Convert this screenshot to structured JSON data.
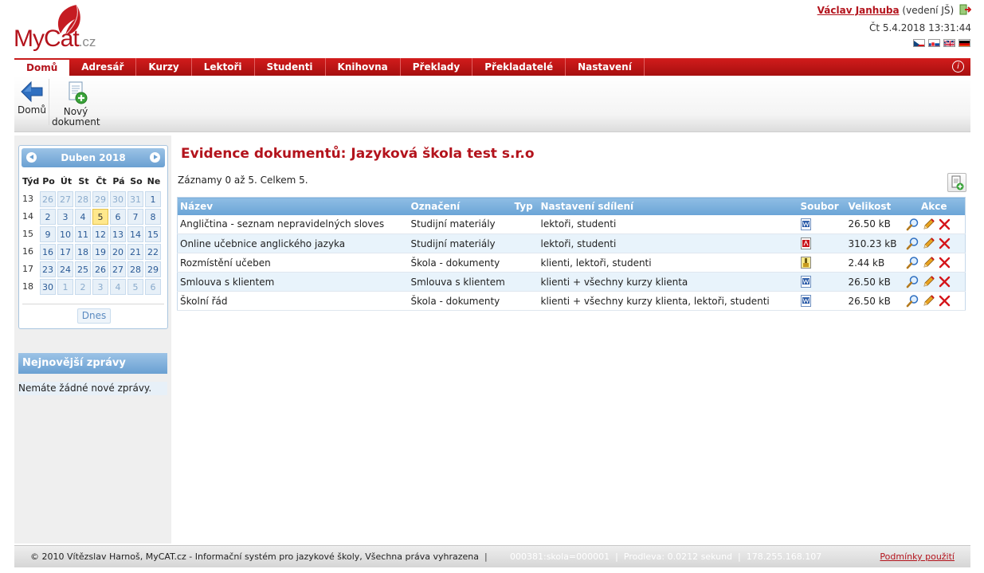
{
  "logo": {
    "text_my": "My",
    "text_cat": "Cat",
    "text_cz": ".cz"
  },
  "user": {
    "name": "Václav Janhuba",
    "role": "(vedení JŠ)",
    "datetime": "Čt 5.4.2018 13:31:44"
  },
  "languages": [
    "cs",
    "sk",
    "en",
    "de"
  ],
  "nav": {
    "items": [
      "Domů",
      "Adresář",
      "Kurzy",
      "Lektoři",
      "Studenti",
      "Knihovna",
      "Překlady",
      "Překladatelé",
      "Nastavení"
    ],
    "active": "Domů",
    "info": "i"
  },
  "toolbar": {
    "home_label": "Domů",
    "new_doc_line1": "Nový",
    "new_doc_line2": "dokument"
  },
  "calendar": {
    "month": "Duben 2018",
    "headers": [
      "Týd",
      "Po",
      "Út",
      "St",
      "Čt",
      "Pá",
      "So",
      "Ne"
    ],
    "weeks": [
      {
        "no": "13",
        "days": [
          "26",
          "27",
          "28",
          "29",
          "30",
          "31",
          "1"
        ]
      },
      {
        "no": "14",
        "days": [
          "2",
          "3",
          "4",
          "5",
          "6",
          "7",
          "8"
        ]
      },
      {
        "no": "15",
        "days": [
          "9",
          "10",
          "11",
          "12",
          "13",
          "14",
          "15"
        ]
      },
      {
        "no": "16",
        "days": [
          "16",
          "17",
          "18",
          "19",
          "20",
          "21",
          "22"
        ]
      },
      {
        "no": "17",
        "days": [
          "23",
          "24",
          "25",
          "26",
          "27",
          "28",
          "29"
        ]
      },
      {
        "no": "18",
        "days": [
          "30",
          "1",
          "2",
          "3",
          "4",
          "5",
          "6"
        ]
      }
    ],
    "today": "5",
    "today_button": "Dnes"
  },
  "news": {
    "title": "Nejnovější zprávy",
    "empty": "Nemáte žádné nové zprávy."
  },
  "main": {
    "title": "Evidence dokumentů: Jazyková škola test s.r.o",
    "records": "Záznamy 0 až 5. Celkem 5.",
    "columns": [
      "Název",
      "Označení",
      "Typ",
      "Nastavení sdílení",
      "Soubor",
      "Velikost",
      "Akce"
    ],
    "rows": [
      {
        "name": "Angličtina - seznam nepravidelných sloves",
        "label": "Studijní materiály",
        "type": "",
        "sharing": "lektoři, studenti",
        "file": "word-icon",
        "size": "26.50 kB"
      },
      {
        "name": "Online učebnice anglického jazyka",
        "label": "Studijní materiály",
        "type": "",
        "sharing": "lektoři, studenti",
        "file": "pdf-icon",
        "size": "310.23 kB"
      },
      {
        "name": "Rozmístění učeben",
        "label": "Škola - dokumenty",
        "type": "",
        "sharing": "klienti, lektoři, studenti",
        "file": "archive-icon",
        "size": "2.44 kB"
      },
      {
        "name": "Smlouva s klientem",
        "label": "Smlouva s klientem",
        "type": "",
        "sharing": "klienti + všechny kurzy klienta",
        "file": "word-icon",
        "size": "26.50 kB"
      },
      {
        "name": "Školní řád",
        "label": "Škola - dokumenty",
        "type": "",
        "sharing": "klienti + všechny kurzy klienta, lektoři, studenti",
        "file": "word-icon",
        "size": "26.50 kB"
      }
    ]
  },
  "footer": {
    "copyright": "© 2010 Vítězslav Harnoš, MyCAT.cz - Informační systém pro jazykové školy, Všechna práva vyhrazena",
    "session": "000381:skola=000001",
    "delay": "Prodleva: 0.0212 sekund",
    "ip": "178.255.168.107",
    "terms": "Podmínky použití"
  },
  "colors": {
    "brand_red": "#b3131c",
    "nav_red": "#c81c1c",
    "header_blue": "#6aa4d6",
    "row_alt": "#e8f3fb",
    "today": "#ffe88c"
  }
}
